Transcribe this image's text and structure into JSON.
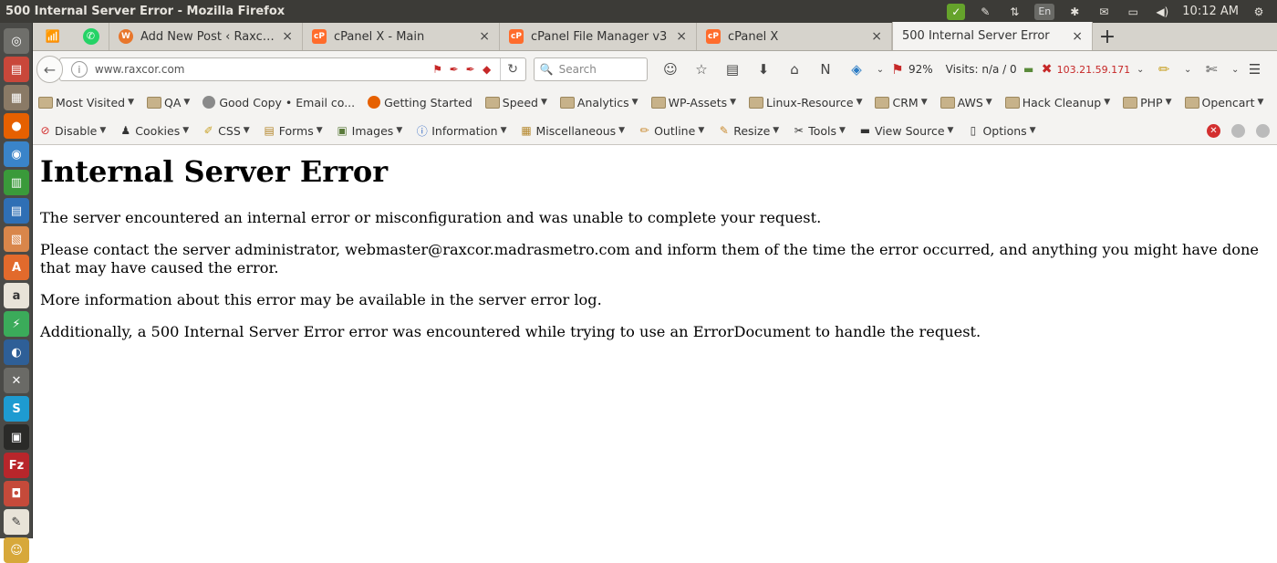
{
  "window": {
    "title": "500 Internal Server Error - Mozilla Firefox",
    "clock": "10:12 AM",
    "keyboard_layout": "En"
  },
  "tabs": [
    {
      "label": "Add New Post ‹ Raxcor —...",
      "favicon": "orange",
      "close": "×"
    },
    {
      "label": "cPanel X - Main",
      "favicon": "cpanel",
      "close": "×"
    },
    {
      "label": "cPanel File Manager v3",
      "favicon": "cpanel",
      "close": "×"
    },
    {
      "label": "cPanel X",
      "favicon": "cpanel",
      "close": "×"
    },
    {
      "label": "500 Internal Server Error",
      "favicon": "none",
      "close": "×",
      "active": true
    }
  ],
  "new_tab_label": "+",
  "navbar": {
    "url": "www.raxcor.com",
    "search_placeholder": "Search",
    "zoom": "92%",
    "visits": "Visits: n/a / 0",
    "ip": "103.21.59.171"
  },
  "bookmarks": [
    {
      "label": "Most Visited",
      "icon": "folder",
      "dropdown": true
    },
    {
      "label": "QA",
      "icon": "folder",
      "dropdown": true
    },
    {
      "label": "Good Copy • Email co...",
      "icon": "globe",
      "dropdown": false
    },
    {
      "label": "Getting Started",
      "icon": "firefox",
      "dropdown": false
    },
    {
      "label": "Speed",
      "icon": "folder",
      "dropdown": true
    },
    {
      "label": "Analytics",
      "icon": "folder",
      "dropdown": true
    },
    {
      "label": "WP-Assets",
      "icon": "folder",
      "dropdown": true
    },
    {
      "label": "Linux-Resource",
      "icon": "folder",
      "dropdown": true
    },
    {
      "label": "CRM",
      "icon": "folder",
      "dropdown": true
    },
    {
      "label": "AWS",
      "icon": "folder",
      "dropdown": true
    },
    {
      "label": "Hack Cleanup",
      "icon": "folder",
      "dropdown": true
    },
    {
      "label": "PHP",
      "icon": "folder",
      "dropdown": true
    },
    {
      "label": "Opencart",
      "icon": "folder",
      "dropdown": true
    }
  ],
  "bookmarks_more": "»",
  "devtools": [
    {
      "label": "Disable",
      "icon": "disable-icon"
    },
    {
      "label": "Cookies",
      "icon": "cookies-icon"
    },
    {
      "label": "CSS",
      "icon": "css-icon"
    },
    {
      "label": "Forms",
      "icon": "forms-icon"
    },
    {
      "label": "Images",
      "icon": "images-icon"
    },
    {
      "label": "Information",
      "icon": "information-icon"
    },
    {
      "label": "Miscellaneous",
      "icon": "miscellaneous-icon"
    },
    {
      "label": "Outline",
      "icon": "outline-icon"
    },
    {
      "label": "Resize",
      "icon": "resize-icon"
    },
    {
      "label": "Tools",
      "icon": "tools-icon"
    },
    {
      "label": "View Source",
      "icon": "view-source-icon"
    },
    {
      "label": "Options",
      "icon": "options-icon"
    }
  ],
  "page": {
    "heading": "Internal Server Error",
    "paragraphs": [
      "The server encountered an internal error or misconfiguration and was unable to complete your request.",
      "Please contact the server administrator, webmaster@raxcor.madrasmetro.com and inform them of the time the error occurred, and anything you might have done that may have caused the error.",
      "More information about this error may be available in the server error log.",
      "Additionally, a 500 Internal Server Error error was encountered while trying to use an ErrorDocument to handle the request."
    ]
  },
  "colors": {
    "os_bar": "#3c3b37",
    "launcher": "#4a4a47",
    "chrome": "#f4f3f1",
    "tabstrip": "#d6d3cc",
    "ip_red": "#c62828"
  }
}
